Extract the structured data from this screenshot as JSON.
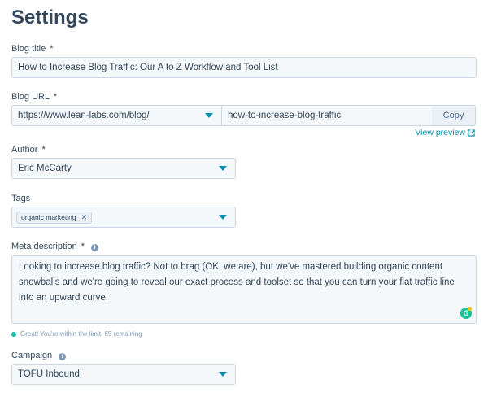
{
  "page": {
    "title": "Settings"
  },
  "blog_title": {
    "label": "Blog title",
    "required_mark": "*",
    "value": "How to Increase Blog Traffic: Our A to Z Workflow and Tool List"
  },
  "blog_url": {
    "label": "Blog URL",
    "required_mark": "*",
    "domain_value": "https://www.lean-labs.com/blog/",
    "slug_value": "how-to-increase-blog-traffic",
    "copy_label": "Copy",
    "view_preview_label": "View preview"
  },
  "author": {
    "label": "Author",
    "required_mark": "*",
    "value": "Eric McCarty"
  },
  "tags": {
    "label": "Tags",
    "items": [
      {
        "label": "organic marketing"
      }
    ]
  },
  "meta_description": {
    "label": "Meta description",
    "required_mark": "*",
    "value": "Looking to increase blog traffic? Not to brag (OK, we are), but we've mastered building organic content snowballs and we're going to reveal our exact process and toolset so that you can turn your flat traffic line into an upward curve.",
    "status_text": "Great! You're within the limit, 65 remaining"
  },
  "campaign": {
    "label": "Campaign",
    "value": "TOFU Inbound"
  },
  "icons": {
    "dropdown": "caret-down-icon",
    "info": "info-icon",
    "external_link": "external-link-icon",
    "remove_tag": "close-icon",
    "grammarly": "grammarly-icon"
  },
  "colors": {
    "accent": "#0091ae",
    "success": "#00bda5",
    "text": "#33475b",
    "field_bg": "#f5f8fa",
    "border": "#cbd6e2"
  }
}
